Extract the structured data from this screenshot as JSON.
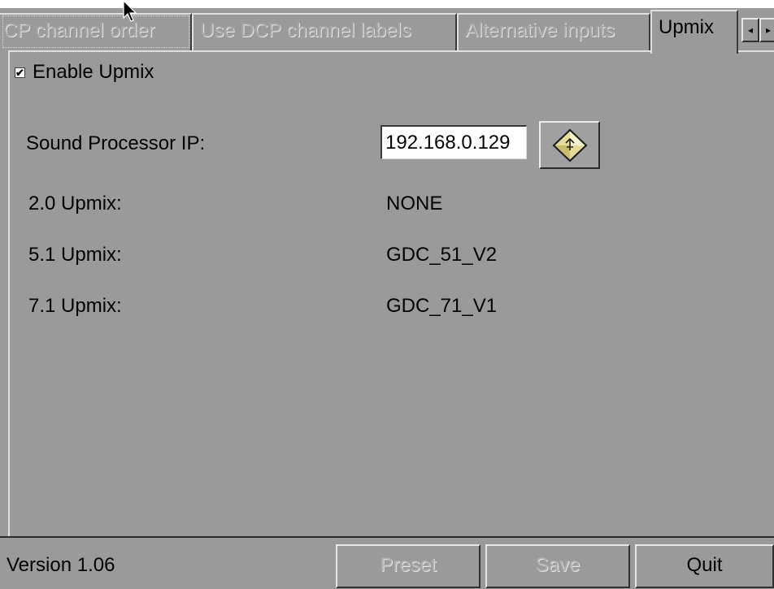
{
  "tabs": [
    {
      "label": "CP channel order",
      "active": false
    },
    {
      "label": "Use DCP channel labels",
      "active": false
    },
    {
      "label": "Alternative inputs",
      "active": false
    },
    {
      "label": "Upmix",
      "active": true
    }
  ],
  "tab_scroll": {
    "left": "◂",
    "right": "▸"
  },
  "upmix": {
    "enable_label": "Enable Upmix",
    "enable_checked": true,
    "enable_mark": "✔",
    "sound_processor_label": "Sound Processor IP:",
    "sound_processor_ip": "192.168.0.129",
    "apply_icon": "arrow-diamond-icon",
    "rows": [
      {
        "label": "2.0 Upmix:",
        "value": "NONE"
      },
      {
        "label": "5.1 Upmix:",
        "value": "GDC_51_V2"
      },
      {
        "label": "7.1 Upmix:",
        "value": "GDC_71_V1"
      }
    ]
  },
  "footer": {
    "version": "Version 1.06",
    "preset_label": "Preset",
    "save_label": "Save",
    "quit_label": "Quit"
  }
}
